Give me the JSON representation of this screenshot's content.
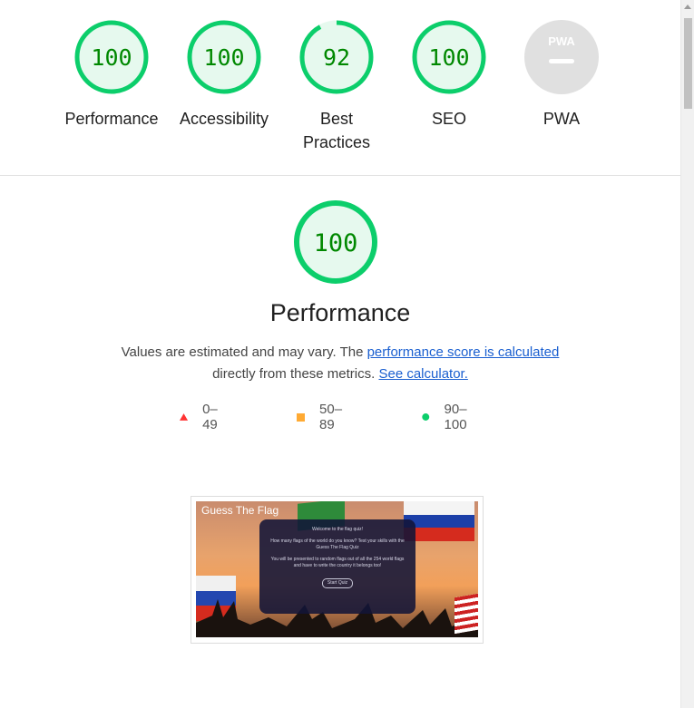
{
  "categories": [
    {
      "label": "Performance",
      "score": "100",
      "value": 100,
      "status": "pass"
    },
    {
      "label": "Accessibility",
      "score": "100",
      "value": 100,
      "status": "pass"
    },
    {
      "label": "Best\nPractices",
      "label_line1": "Best",
      "label_line2": "Practices",
      "score": "92",
      "value": 92,
      "status": "pass"
    },
    {
      "label": "SEO",
      "score": "100",
      "value": 100,
      "status": "pass"
    },
    {
      "label": "PWA",
      "badge": "PWA",
      "status": "na"
    }
  ],
  "performance": {
    "score": "100",
    "value": 100,
    "title": "Performance",
    "desc_part1": "Values are estimated and may vary. The ",
    "link1": "performance score is calculated",
    "desc_part2": "directly from these metrics. ",
    "link2": "See calculator."
  },
  "legend": [
    {
      "range": "0–49",
      "shape": "triangle",
      "color": "#ff3333"
    },
    {
      "range": "50–89",
      "shape": "square",
      "color": "#ffaa33"
    },
    {
      "range": "90–100",
      "shape": "circle",
      "color": "#0cce6b"
    }
  ],
  "preview": {
    "title": "Guess The Flag",
    "modal_heading": "Welcome to the flag quiz!",
    "modal_p1": "How many flags of the world do you know? Test your skills with the Guess The Flag Quiz",
    "modal_p2": "You will be presented to random flags out of all the 254 world flags and have to write the country it belongs too!",
    "modal_button": "Start Quiz"
  },
  "colors": {
    "pass": "#0cce6b",
    "pass_text": "#008800",
    "pass_fill": "#e6f9ee",
    "na_fill": "#e0e0e0",
    "link": "#1a5fd0"
  }
}
